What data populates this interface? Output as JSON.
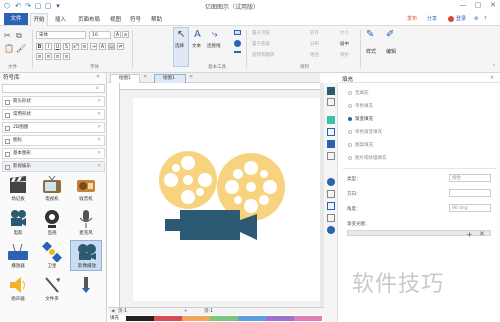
{
  "app": {
    "title": "亿图图示（试用版）"
  },
  "quick_access": [
    "↶",
    "↷",
    "▢",
    "▢",
    "▾"
  ],
  "menu": {
    "file": "文件",
    "tabs": [
      "开始",
      "插入",
      "页面布局",
      "视图",
      "符号",
      "帮助"
    ],
    "right_links": [
      "发布",
      "分享",
      "登录"
    ]
  },
  "ribbon": {
    "font_name": "宋体",
    "font_size": "10",
    "group_labels": [
      "文件",
      "字体",
      "基本工具",
      "排列"
    ],
    "tools": [
      "选择",
      "文本",
      "连接线"
    ],
    "arrange_items": [
      "置于顶层",
      "置于底层",
      "旋转和翻转",
      "对齐",
      "分布",
      "组合",
      "大小",
      "居中",
      "保护"
    ],
    "style_label": "样式",
    "edit_label": "编辑"
  },
  "library": {
    "title": "符号库",
    "categories": [
      "箭头形状",
      "常用形状",
      "2D图图",
      "图标",
      "基本图形",
      "影视娱乐"
    ],
    "symbols": [
      "场记板",
      "电视机",
      "收音机",
      "电影",
      "监视",
      "麦克风",
      "播放器",
      "卫星",
      "影像播放",
      "扬声器",
      "文件夹",
      ""
    ],
    "selected_symbol": "影像播放"
  },
  "document": {
    "tabs": [
      "绘图1",
      "绘图1"
    ],
    "page_label": "页-1",
    "page_tab": "页-1",
    "fill_label": "填充"
  },
  "right_panel": {
    "title": "填充",
    "fill_options": [
      "无填充",
      "单色填充",
      "渐变填充",
      "单色渐变填充",
      "图案填充",
      "图片或纹理填充"
    ],
    "selected_fill": "渐变填充",
    "properties": [
      {
        "label": "类型：",
        "value": "线性"
      },
      {
        "label": "方向：",
        "value": ""
      },
      {
        "label": "角度：",
        "value": "90 deg"
      },
      {
        "label": "渐变光圈：",
        "value": ""
      }
    ]
  },
  "watermark": "软件技巧",
  "colors": {
    "accent": "#2b62b6",
    "reel": "#f7d37f",
    "camera": "#2c5a72"
  }
}
